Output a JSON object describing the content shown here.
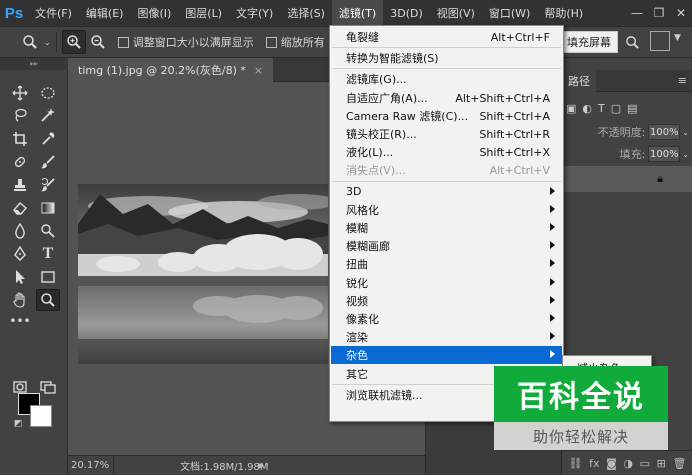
{
  "app": {
    "logo": "Ps"
  },
  "menubar": {
    "items": [
      "文件(F)",
      "编辑(E)",
      "图像(I)",
      "图层(L)",
      "文字(Y)",
      "选择(S)",
      "滤镜(T)",
      "3D(D)",
      "视图(V)",
      "窗口(W)",
      "帮助(H)"
    ],
    "active_index": 6,
    "window_controls": [
      "—",
      "❐",
      "✕"
    ]
  },
  "options": {
    "resize_windows_label": "调整窗口大小以满屏显示",
    "zoom_all_label": "缩放所有",
    "fill_screen_label": "填充屏幕"
  },
  "document": {
    "tab_title": "timg (1).jpg @ 20.2%(灰色/8) *",
    "tab_close": "×",
    "zoom": "20.17%",
    "info": "文档:1.98M/1.98M"
  },
  "panel": {
    "tab_label": "路径",
    "opacity_label": "不透明度:",
    "opacity_value": "100%",
    "fill_label": "填充:",
    "fill_value": "100%"
  },
  "filter_menu": {
    "items": [
      {
        "label": "龟裂缝",
        "shortcut": "Alt+Ctrl+F"
      },
      {
        "sep": true
      },
      {
        "label": "转换为智能滤镜(S)"
      },
      {
        "sep": true
      },
      {
        "label": "滤镜库(G)..."
      },
      {
        "label": "自适应广角(A)...",
        "shortcut": "Alt+Shift+Ctrl+A"
      },
      {
        "label": "Camera Raw 滤镜(C)...",
        "shortcut": "Shift+Ctrl+A"
      },
      {
        "label": "镜头校正(R)...",
        "shortcut": "Shift+Ctrl+R"
      },
      {
        "label": "液化(L)...",
        "shortcut": "Shift+Ctrl+X"
      },
      {
        "label": "消失点(V)...",
        "shortcut": "Alt+Ctrl+V",
        "disabled": true
      },
      {
        "sep": true
      },
      {
        "label": "3D",
        "submenu": true
      },
      {
        "label": "风格化",
        "submenu": true
      },
      {
        "label": "模糊",
        "submenu": true
      },
      {
        "label": "模糊画廊",
        "submenu": true
      },
      {
        "label": "扭曲",
        "submenu": true
      },
      {
        "label": "锐化",
        "submenu": true
      },
      {
        "label": "视频",
        "submenu": true
      },
      {
        "label": "像素化",
        "submenu": true
      },
      {
        "label": "渲染",
        "submenu": true
      },
      {
        "label": "杂色",
        "submenu": true,
        "highlighted": true
      },
      {
        "label": "其它",
        "submenu": true
      },
      {
        "sep": true
      },
      {
        "label": "浏览联机滤镜..."
      }
    ]
  },
  "submenu": {
    "first_item": "减少杂色"
  },
  "watermark": {
    "title": "百科全说",
    "subtitle": "助你轻松解决",
    "color": "#11ab3c"
  },
  "colors": {
    "menu_highlight": "#0a6ad4",
    "brand": "#31a8ff"
  }
}
